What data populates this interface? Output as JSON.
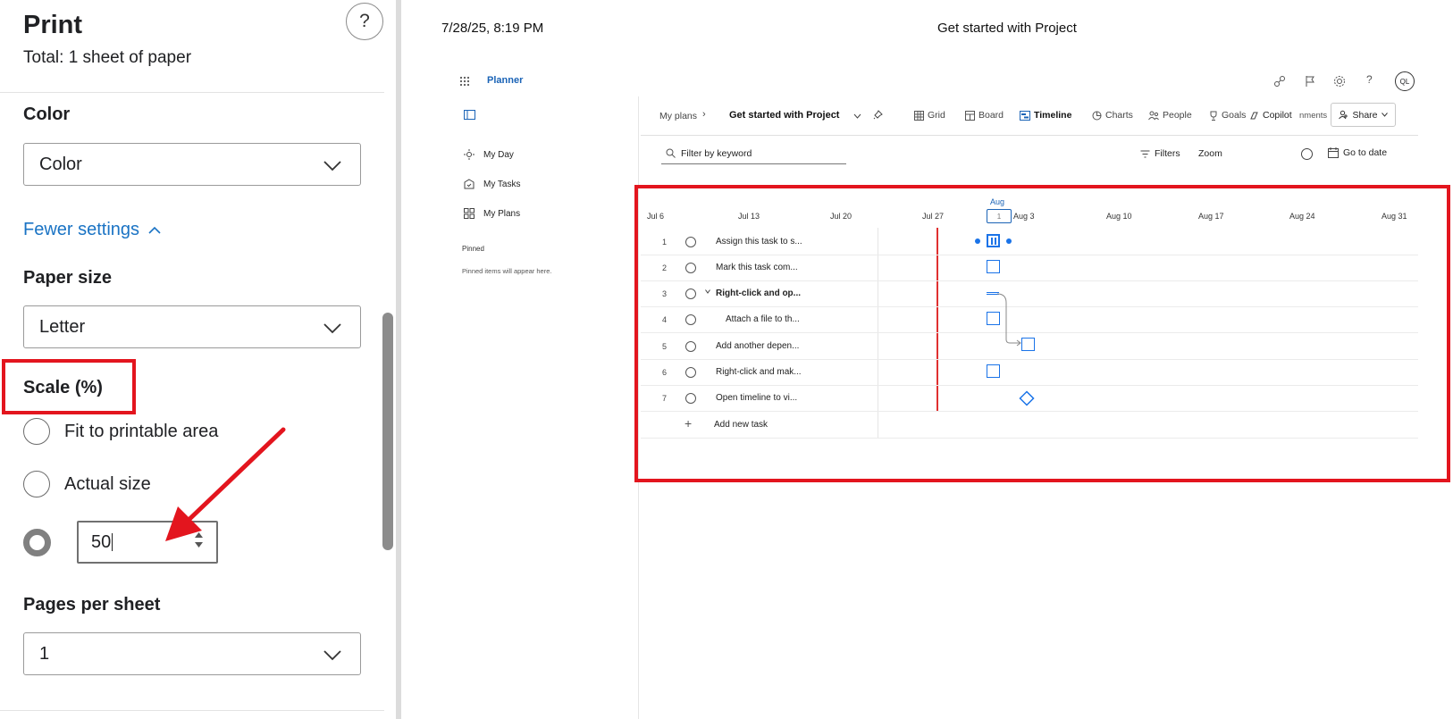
{
  "print_panel": {
    "title": "Print",
    "total": "Total: 1 sheet of paper",
    "help_label": "?",
    "color": {
      "label": "Color",
      "value": "Color"
    },
    "fewer_settings": "Fewer settings",
    "paper_size": {
      "label": "Paper size",
      "value": "Letter"
    },
    "scale": {
      "label": "Scale (%)",
      "fit_label": "Fit to printable area",
      "actual_label": "Actual size",
      "custom_value": "50"
    },
    "pages_per_sheet": {
      "label": "Pages per sheet",
      "value": "1"
    }
  },
  "preview": {
    "header_date": "7/28/25, 8:19 PM",
    "header_title": "Get started with Project",
    "app_name": "Planner",
    "user_initials": "QL",
    "nav": {
      "my_day": "My Day",
      "my_tasks": "My Tasks",
      "my_plans": "My Plans",
      "pinned_heading": "Pinned",
      "pinned_empty": "Pinned items will appear here."
    },
    "breadcrumb": {
      "root": "My plans",
      "plan": "Get started with Project"
    },
    "tabs": [
      "Grid",
      "Board",
      "Timeline",
      "Charts",
      "People",
      "Goals"
    ],
    "copilot": "Copilot",
    "comments_partial": "nments",
    "share": "Share",
    "filter_placeholder": "Filter by keyword",
    "filters": "Filters",
    "zoom": "Zoom",
    "go_to_date": "Go to date",
    "timeline": {
      "month": "Aug",
      "today_day": "1",
      "dates": [
        "Jul 6",
        "Jul 13",
        "Jul 20",
        "Jul 27",
        "Aug 3",
        "Aug 10",
        "Aug 17",
        "Aug 24",
        "Aug 31"
      ]
    },
    "tasks": [
      {
        "num": "1",
        "name": "Assign this task to s...",
        "bold": false
      },
      {
        "num": "2",
        "name": "Mark this task com...",
        "bold": false
      },
      {
        "num": "3",
        "name": "Right-click and op...",
        "bold": true
      },
      {
        "num": "4",
        "name": "Attach a file to th...",
        "bold": false
      },
      {
        "num": "5",
        "name": "Add another depen...",
        "bold": false
      },
      {
        "num": "6",
        "name": "Right-click and mak...",
        "bold": false
      },
      {
        "num": "7",
        "name": "Open timeline to vi...",
        "bold": false
      }
    ],
    "add_task": "Add new task"
  },
  "colors": {
    "accent": "#1a73c4",
    "annotation": "#e3151e",
    "today_line": "#e03030"
  },
  "icons": [
    "help-icon",
    "chevron-down-icon",
    "chevron-up-icon",
    "spinner-icon",
    "app-launcher-icon",
    "sun-icon",
    "tasks-icon",
    "plans-icon",
    "pin-icon",
    "grid-icon",
    "board-icon",
    "timeline-icon",
    "charts-icon",
    "people-icon",
    "goals-icon",
    "copilot-icon",
    "share-icon",
    "search-icon",
    "filter-icon",
    "calendar-icon",
    "settings-icon",
    "flag-icon",
    "arrow-annotation"
  ]
}
